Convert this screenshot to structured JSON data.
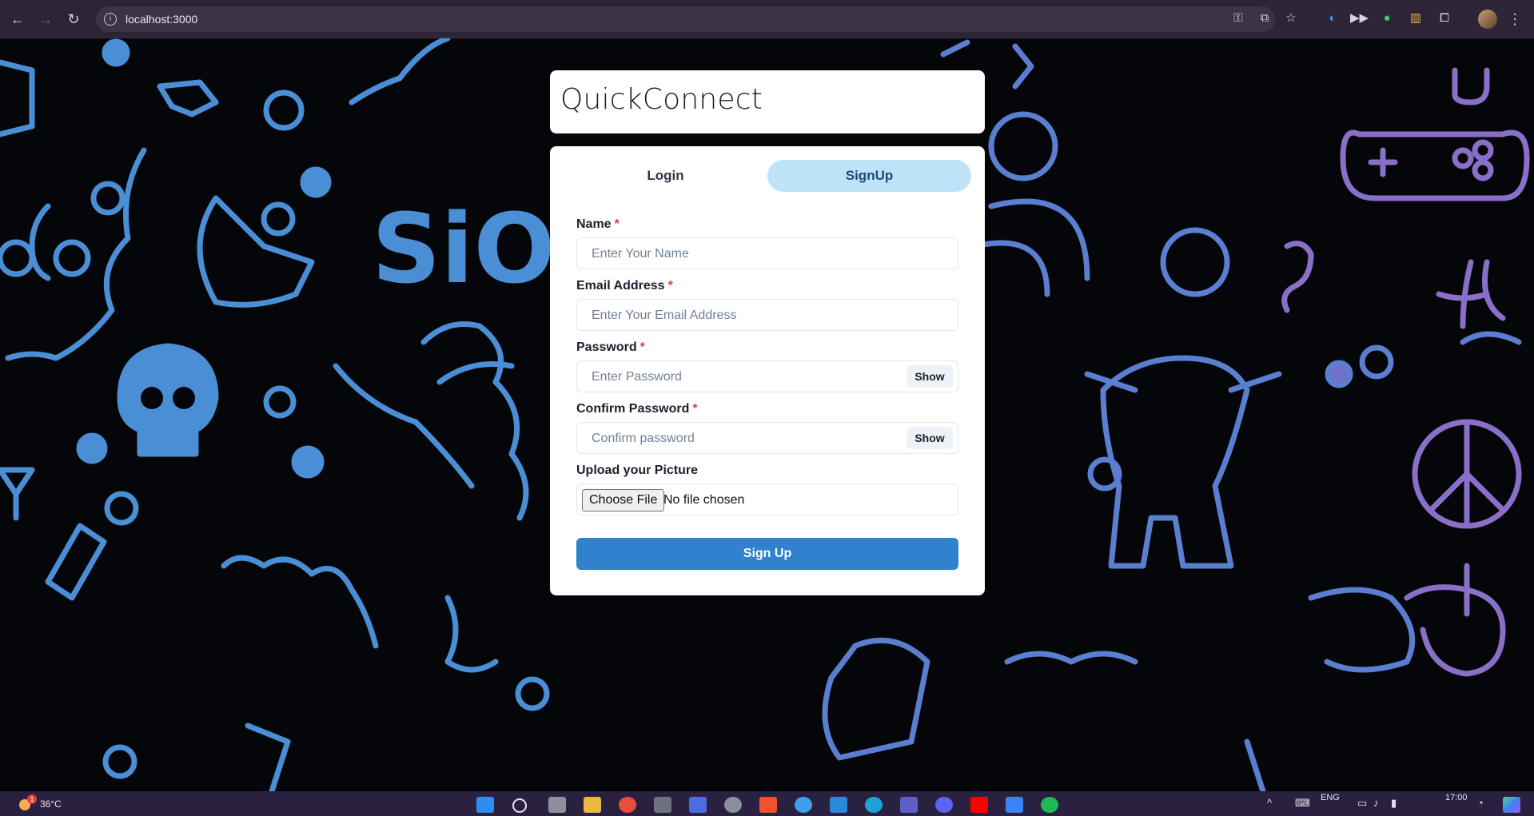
{
  "browser": {
    "url": "localhost:3000",
    "back_icon": "back-arrow-icon",
    "forward_icon": "forward-arrow-icon",
    "reload_icon": "reload-icon"
  },
  "app": {
    "title": "QuickConnect"
  },
  "tabs": [
    {
      "label": "Login",
      "active": false
    },
    {
      "label": "SignUp",
      "active": true
    }
  ],
  "form": {
    "name": {
      "label": "Name",
      "required_mark": "*",
      "placeholder": "Enter Your Name"
    },
    "email": {
      "label": "Email Address",
      "required_mark": "*",
      "placeholder": "Enter Your Email Address"
    },
    "password": {
      "label": "Password",
      "required_mark": "*",
      "placeholder": "Enter Password",
      "toggle": "Show"
    },
    "confirm": {
      "label": "Confirm Password",
      "required_mark": "*",
      "placeholder": "Confirm password",
      "toggle": "Show"
    },
    "picture": {
      "label": "Upload your Picture",
      "button": "Choose File",
      "status": "No file chosen"
    },
    "submit": "Sign Up"
  },
  "colors": {
    "accent": "#3182ce",
    "active_tab": "#bee3f8",
    "required": "#e53e3e",
    "background_art": "#4a90d9"
  },
  "taskbar": {
    "temperature": "36°C",
    "weather_badge": "1",
    "language": "ENG",
    "time": "17:00"
  }
}
